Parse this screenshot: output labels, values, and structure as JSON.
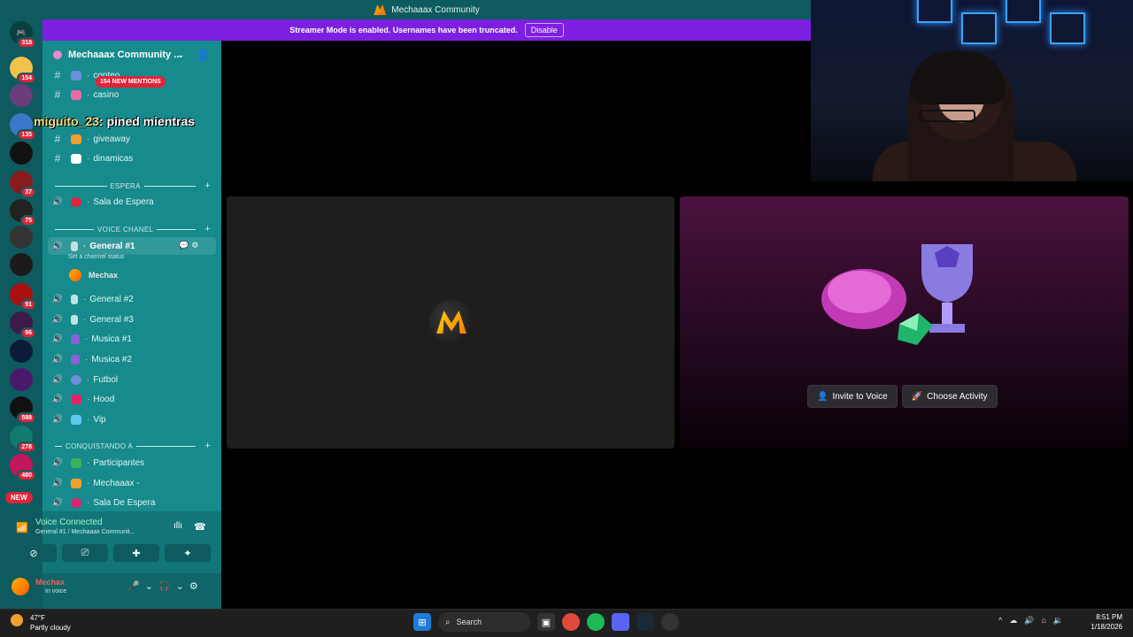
{
  "window": {
    "title": "Mechaaax Community"
  },
  "streamer_banner": {
    "text": "Streamer Mode is enabled. Usernames have been truncated.",
    "disable_label": "Disable"
  },
  "server_rail": {
    "badges": [
      "318",
      "154",
      "135",
      "37",
      "75",
      "91",
      "96",
      "588",
      "278",
      "480"
    ],
    "new_label": "NEW"
  },
  "guild": {
    "name": "Mechaaax Community ..."
  },
  "mentions_pill": "154 NEW MENTIONS",
  "overlay": {
    "user": "miguito_23",
    "text": ": pined mientras"
  },
  "channels": {
    "text": [
      {
        "name": "casino",
        "color": "#e86aa8"
      },
      {
        "name": "giveaway",
        "color": "#f0a030"
      },
      {
        "name": "dinamicas",
        "color": "#ffffff"
      }
    ],
    "partial_top": "conteo",
    "cat_espera": "ESPERA",
    "espera": [
      {
        "name": "Sala de Espera",
        "color": "#e0243a"
      }
    ],
    "cat_voice": "VOICE CHANEL",
    "voice": [
      {
        "name": "General #1",
        "active": true
      },
      {
        "name": "General #2"
      },
      {
        "name": "General #3"
      },
      {
        "name": "Musica #1"
      },
      {
        "name": "Musica #2"
      },
      {
        "name": "Futbol"
      },
      {
        "name": "Hood"
      },
      {
        "name": "Vip"
      }
    ],
    "status_hint": "Set a channel status",
    "member": "Mechax",
    "cat_conq": "CONQUISTANDO A",
    "conq": [
      {
        "name": "Participantes"
      },
      {
        "name": "Mechaaax -"
      },
      {
        "name": "Sala De Espera"
      }
    ]
  },
  "voice_panel": {
    "title": "Voice Connected",
    "sub": "General #1 / Mechaaax Communit..."
  },
  "userbar": {
    "name": "Mechax",
    "status": "In voice"
  },
  "stage": {
    "invite_label": "Invite to Voice",
    "activity_label": "Choose Activity"
  },
  "taskbar": {
    "temp": "47°F",
    "weather": "Partly cloudy",
    "search": "Search",
    "time": "8:51 PM",
    "date": "1/18/2026"
  }
}
